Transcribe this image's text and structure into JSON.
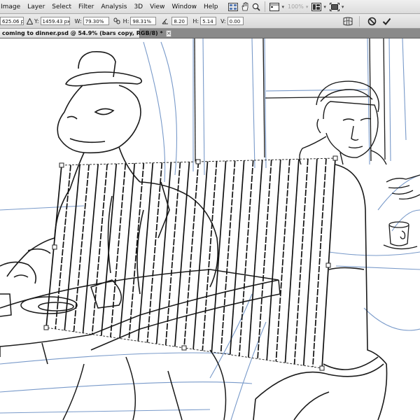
{
  "menu": {
    "items": [
      "Image",
      "Layer",
      "Select",
      "Filter",
      "Analysis",
      "3D",
      "View",
      "Window",
      "Help"
    ],
    "zoom": "100%"
  },
  "options": {
    "x_value": "625.06 px",
    "y_label": "Y:",
    "y_value": "1459.43 px",
    "w_label": "W:",
    "w_value": "79.30%",
    "h_label": "H:",
    "h_value": "98.31%",
    "angle_value": "8.20",
    "hskew_label": "H:",
    "hskew_value": "5.14",
    "vskew_label": "V:",
    "vskew_value": "0.00"
  },
  "document": {
    "tab_title": "coming to dinner.psd @ 54.9% (bars copy, RGB/8) *",
    "close_glyph": "×"
  },
  "colors": {
    "sketch_blue": "#6a8fc4",
    "ink": "#1a1a1a",
    "menubar_bg": "#e4e4e4",
    "tab_bg": "#8a8a8a"
  }
}
